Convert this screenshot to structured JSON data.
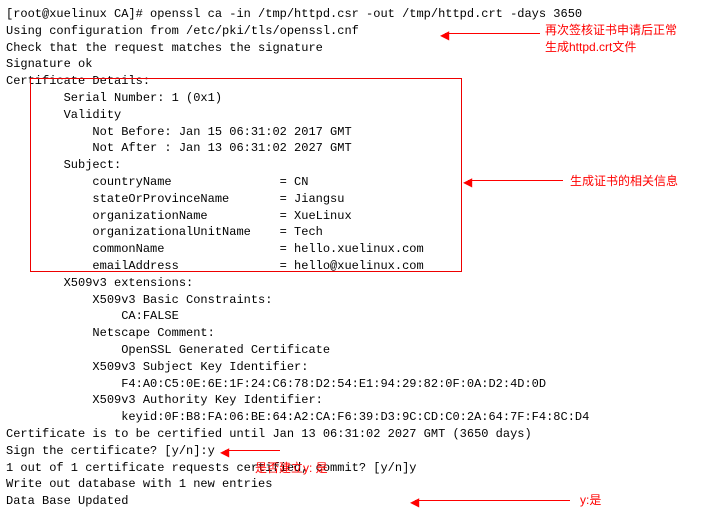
{
  "lines": {
    "l0": "[root@xuelinux CA]# openssl ca -in /tmp/httpd.csr -out /tmp/httpd.crt -days 3650",
    "l1": "Using configuration from /etc/pki/tls/openssl.cnf",
    "l2": "Check that the request matches the signature",
    "l3": "Signature ok",
    "l4": "Certificate Details:",
    "l5": "        Serial Number: 1 (0x1)",
    "l6": "        Validity",
    "l7": "            Not Before: Jan 15 06:31:02 2017 GMT",
    "l8": "            Not After : Jan 13 06:31:02 2027 GMT",
    "l9": "        Subject:",
    "l10": "            countryName               = CN",
    "l11": "            stateOrProvinceName       = Jiangsu",
    "l12": "            organizationName          = XueLinux",
    "l13": "            organizationalUnitName    = Tech",
    "l14": "            commonName                = hello.xuelinux.com",
    "l15": "            emailAddress              = hello@xuelinux.com",
    "l16": "        X509v3 extensions:",
    "l17": "            X509v3 Basic Constraints:",
    "l18": "                CA:FALSE",
    "l19": "            Netscape Comment:",
    "l20": "                OpenSSL Generated Certificate",
    "l21": "            X509v3 Subject Key Identifier:",
    "l22": "                F4:A0:C5:0E:6E:1F:24:C6:78:D2:54:E1:94:29:82:0F:0A:D2:4D:0D",
    "l23": "            X509v3 Authority Key Identifier:",
    "l24": "                keyid:0F:B8:FA:06:BE:64:A2:CA:F6:39:D3:9C:CD:C0:2A:64:7F:F4:8C:D4",
    "l25": "",
    "l26": "Certificate is to be certified until Jan 13 06:31:02 2027 GMT (3650 days)",
    "l27": "Sign the certificate? [y/n]:y",
    "l28": "",
    "l29": "",
    "l30": "1 out of 1 certificate requests certified, commit? [y/n]y",
    "l31": "Write out database with 1 new entries",
    "l32": "Data Base Updated"
  },
  "annotations": {
    "a1_line1": "再次签核证书申请后正常",
    "a1_line2": "生成httpd.crt文件",
    "a2": "生成证书的相关信息",
    "a3": "是否建立y: 是",
    "a4": "y:是"
  }
}
